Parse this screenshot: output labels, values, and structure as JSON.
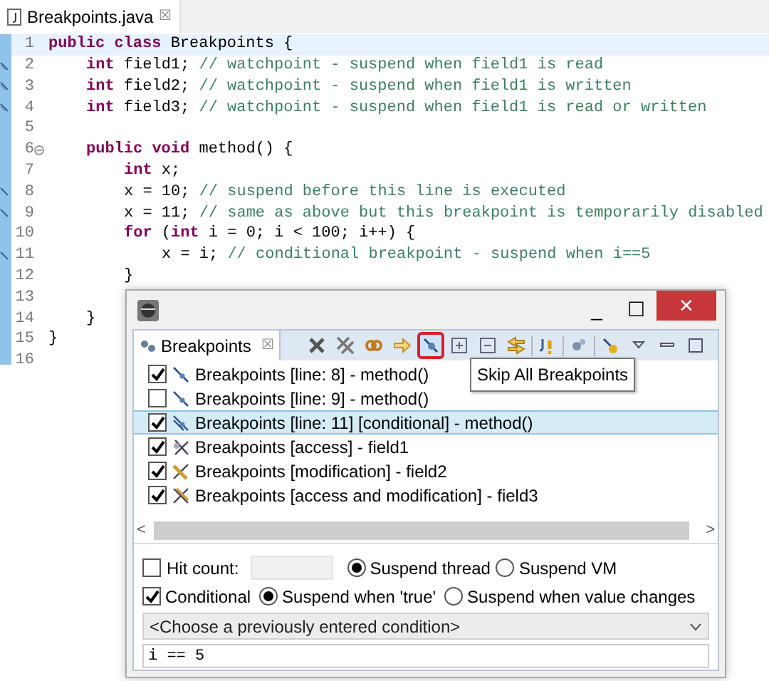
{
  "editor": {
    "tab": {
      "title": "Breakpoints.java",
      "close": "☒"
    },
    "lines": [
      {
        "number": "1",
        "current": true,
        "segments": [
          {
            "kind": "keyword",
            "text": "public class"
          },
          {
            "kind": "plain",
            "text": " Breakpoints {"
          }
        ],
        "children": [
          {
            "number": "2",
            "kind": "watchpoint",
            "current": false,
            "segments": [
              {
                "kind": "keyword",
                "text": "int"
              },
              {
                "kind": "plain",
                "text": " field1;"
              },
              {
                "kind": "comment",
                "text": " // watchpoint - suspend when field1 is read"
              }
            ]
          },
          {
            "number": "3",
            "kind": "watchpoint",
            "current": false,
            "segments": [
              {
                "kind": "keyword",
                "text": "int"
              },
              {
                "kind": "plain",
                "text": " field2;"
              },
              {
                "kind": "comment",
                "text": " // watchpoint - suspend when field1 is written"
              }
            ]
          },
          {
            "number": "4",
            "kind": "watchpoint",
            "current": false,
            "segments": [
              {
                "kind": "keyword",
                "text": "int"
              },
              {
                "kind": "plain",
                "text": " field3;"
              },
              {
                "kind": "comment",
                "text": " // watchpoint - suspend when field1 is read or written"
              }
            ]
          },
          {
            "number": "5",
            "current": false
          },
          {
            "number": "6",
            "kind": "fold",
            "current": false,
            "segments": [
              {
                "kind": "keyword",
                "text": "public void"
              },
              {
                "kind": "plain",
                "text": " method() {"
              }
            ],
            "children": [
              {
                "number": "7",
                "current": false,
                "segments": [
                  {
                    "kind": "keyword",
                    "text": "int"
                  },
                  {
                    "kind": "plain",
                    "text": " x;"
                  }
                ]
              },
              {
                "number": "8",
                "kind": "breakpoint",
                "current": false,
                "segments": [
                  {
                    "kind": "plain",
                    "text": "x = 10;"
                  },
                  {
                    "kind": "comment",
                    "text": " // suspend before this line is executed"
                  }
                ]
              },
              {
                "number": "9",
                "kind": "breakpoint",
                "current": false,
                "segments": [
                  {
                    "kind": "plain",
                    "text": "x = 11;"
                  },
                  {
                    "kind": "comment",
                    "text": " // same as above but this breakpoint is temporarily disabled"
                  }
                ]
              },
              {
                "number": "10",
                "current": false,
                "segments": [
                  {
                    "kind": "keyword",
                    "text": "for"
                  },
                  {
                    "kind": "plain",
                    "text": " ("
                  },
                  {
                    "kind": "keyword",
                    "text": "int"
                  },
                  {
                    "kind": "plain",
                    "text": " i = 0; i < 100; i++) {"
                  }
                ],
                "children": [
                  {
                    "number": "11",
                    "kind": "breakpoint",
                    "current": false,
                    "segments": [
                      {
                        "kind": "plain",
                        "text": "x = i;"
                      },
                      {
                        "kind": "comment",
                        "text": " // conditional breakpoint - suspend when i==5"
                      }
                    ]
                  }
                ]
              },
              {
                "number": "12",
                "current": false,
                "segments": [
                  {
                    "kind": "plain",
                    "text": "}"
                  }
                ]
              },
              {
                "number": "13",
                "current": false
              }
            ]
          },
          {
            "number": "14",
            "current": false,
            "segments": [
              {
                "kind": "plain",
                "text": "}"
              }
            ]
          }
        ]
      },
      {
        "number": "15",
        "current": false,
        "segments": [
          {
            "kind": "plain",
            "text": "}"
          }
        ]
      },
      {
        "number": "16",
        "current": false
      }
    ]
  },
  "dialog": {
    "window_controls": {
      "minimize": "_",
      "maximize": "☐",
      "close": "✕"
    },
    "tab": {
      "title": "Breakpoints",
      "close": "☒"
    },
    "toolbar": [
      {
        "kind": "remove",
        "pressed": false
      },
      {
        "kind": "remove-all",
        "pressed": false
      },
      {
        "kind": "link",
        "pressed": false
      },
      {
        "kind": "goto",
        "pressed": false
      },
      {
        "kind": "skip",
        "pressed": true
      },
      {
        "kind": "expand",
        "pressed": false
      },
      {
        "kind": "collapse",
        "pressed": false
      },
      {
        "kind": "sync",
        "pressed": false
      },
      {
        "kind": "separator"
      },
      {
        "kind": "java",
        "pressed": false
      },
      {
        "kind": "separator"
      },
      {
        "kind": "group",
        "pressed": false
      },
      {
        "kind": "separator"
      },
      {
        "kind": "settings",
        "pressed": false
      },
      {
        "kind": "view-menu",
        "pressed": false
      },
      {
        "kind": "minimize",
        "pressed": false
      },
      {
        "kind": "maximize",
        "pressed": false
      }
    ],
    "tooltip": "Skip All Breakpoints",
    "breakpoints": [
      {
        "kind": "line",
        "checked": true,
        "selected": false,
        "label": "Breakpoints [line: 8] - method()"
      },
      {
        "kind": "line",
        "checked": false,
        "selected": false,
        "label": "Breakpoints [line: 9] - method()"
      },
      {
        "kind": "conditional",
        "checked": true,
        "selected": true,
        "label": "Breakpoints [line: 11] [conditional] - method()"
      },
      {
        "kind": "access",
        "checked": true,
        "selected": false,
        "label": "Breakpoints [access] - field1"
      },
      {
        "kind": "modification",
        "checked": true,
        "selected": false,
        "label": "Breakpoints [modification] - field2"
      },
      {
        "kind": "access-modification",
        "checked": true,
        "selected": false,
        "label": "Breakpoints [access and modification] - field3"
      }
    ],
    "scrollbar": {
      "left": "<",
      "right": ">"
    },
    "hit_count": {
      "label": "Hit count:",
      "checked": false
    },
    "suspend_options": [
      {
        "label": "Suspend thread",
        "selected": true
      },
      {
        "label": "Suspend VM",
        "selected": false
      }
    ],
    "conditional": {
      "label": "Conditional",
      "checked": true
    },
    "condition_options": [
      {
        "label": "Suspend when 'true'",
        "selected": true
      },
      {
        "label": "Suspend when value changes",
        "selected": false
      }
    ],
    "condition_history": {
      "placeholder": "<Choose a previously entered condition>"
    },
    "condition": {
      "value": "i == 5"
    }
  }
}
